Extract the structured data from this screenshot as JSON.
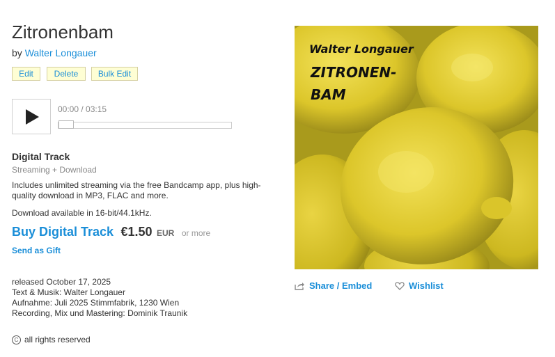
{
  "track": {
    "title": "Zitronenbam",
    "by_prefix": "by",
    "artist": "Walter Longauer"
  },
  "admin": {
    "edit_label": "Edit",
    "delete_label": "Delete",
    "bulk_edit_label": "Bulk Edit"
  },
  "player": {
    "current_time": "00:00",
    "separator": " / ",
    "duration": "03:15",
    "progress_fraction": 0
  },
  "package": {
    "title": "Digital Track",
    "subtitle": "Streaming + Download",
    "description": "Includes unlimited streaming via the free Bandcamp app, plus high-quality download in MP3, FLAC and more.",
    "download_note": "Download available in 16-bit/44.1kHz.",
    "buy_label": "Buy Digital Track",
    "price": "€1.50",
    "currency": "EUR",
    "or_more": "or more",
    "gift_label": "Send as Gift"
  },
  "credits": {
    "released": "released October 17, 2025",
    "line1": "Text & Musik: Walter Longauer",
    "line2": "Aufnahme: Juli 2025 Stimmfabrik, 1230 Wien",
    "line3": "Recording, Mix und Mastering: Dominik Traunik"
  },
  "license": {
    "icon": "copyright-icon",
    "text": "all rights reserved"
  },
  "artwork": {
    "artist_text": "Walter Longauer",
    "title_line1": "ZITRONEN-",
    "title_line2": "BAM",
    "lemon_color": "#e6cf2c",
    "background_color": "#a99a1c"
  },
  "actions": {
    "share_label": "Share / Embed",
    "share_icon": "share-icon",
    "wishlist_label": "Wishlist",
    "wishlist_icon": "heart-icon"
  },
  "colors": {
    "link": "#1a8ed8",
    "admin_button_bg": "#fefed4"
  }
}
